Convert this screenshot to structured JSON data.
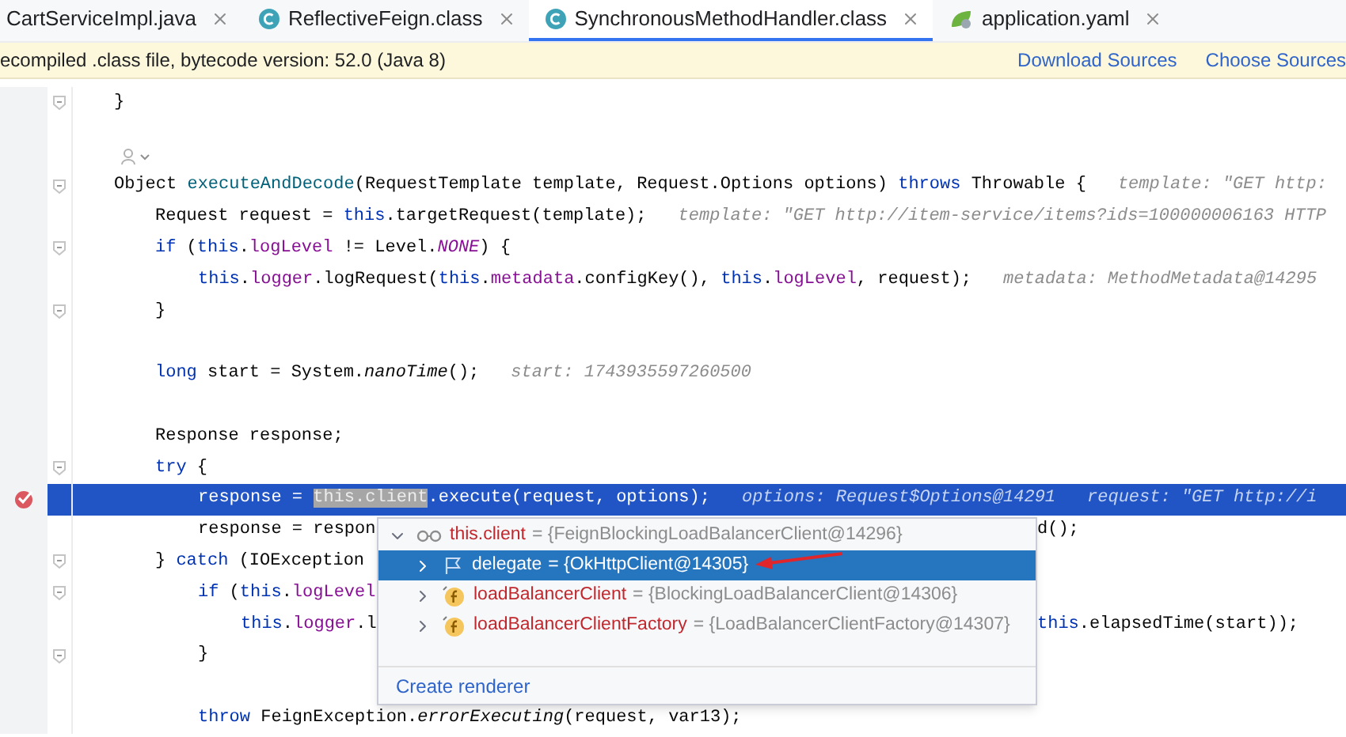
{
  "tabs": [
    {
      "label": "CartServiceImpl.java",
      "kind": "plain",
      "selected": false
    },
    {
      "label": "ReflectiveFeign.class",
      "kind": "class",
      "selected": false
    },
    {
      "label": "SynchronousMethodHandler.class",
      "kind": "class",
      "selected": true
    },
    {
      "label": "application.yaml",
      "kind": "yaml",
      "selected": false
    }
  ],
  "banner": {
    "message": "ecompiled .class file, bytecode version: 52.0 (Java 8)",
    "actions": [
      "Download Sources",
      "Choose Sources"
    ]
  },
  "code_lines": [
    {
      "kind": "code",
      "fold": true,
      "breakpoint": false,
      "highlighted": false,
      "code": [
        {
          "text": "}",
          "kind": "plain"
        }
      ]
    },
    {
      "kind": "blank",
      "fold": false,
      "breakpoint": false,
      "highlighted": false
    },
    {
      "kind": "inlay",
      "fold": false,
      "breakpoint": false,
      "highlighted": false
    },
    {
      "kind": "code",
      "fold": true,
      "breakpoint": false,
      "highlighted": false,
      "code": [
        {
          "text": "Object ",
          "kind": "plain"
        },
        {
          "text": "executeAndDecode",
          "kind": "method"
        },
        {
          "text": "(RequestTemplate template, Request.Options options) ",
          "kind": "plain"
        },
        {
          "text": "throws",
          "kind": "keyword"
        },
        {
          "text": " Throwable {",
          "kind": "plain"
        }
      ],
      "hints": [
        "template: \"GET http:"
      ],
      "children": [
        {
          "kind": "code",
          "fold": false,
          "breakpoint": false,
          "highlighted": false,
          "code": [
            {
              "text": "Request request = ",
              "kind": "plain"
            },
            {
              "text": "this",
              "kind": "keyword"
            },
            {
              "text": ".targetRequest(template);",
              "kind": "plain"
            }
          ],
          "hints": [
            "template: \"GET http://item-service/items?ids=100000006163 HTTP"
          ]
        },
        {
          "kind": "code",
          "fold": true,
          "breakpoint": false,
          "highlighted": false,
          "code": [
            {
              "text": "if",
              "kind": "keyword"
            },
            {
              "text": " (",
              "kind": "plain"
            },
            {
              "text": "this",
              "kind": "keyword"
            },
            {
              "text": ".",
              "kind": "plain"
            },
            {
              "text": "logLevel",
              "kind": "field"
            },
            {
              "text": " != Level.",
              "kind": "plain"
            },
            {
              "text": "NONE",
              "kind": "constant"
            },
            {
              "text": ") {",
              "kind": "plain"
            }
          ],
          "children": [
            {
              "kind": "code",
              "fold": false,
              "breakpoint": false,
              "highlighted": false,
              "code": [
                {
                  "text": "this",
                  "kind": "keyword"
                },
                {
                  "text": ".",
                  "kind": "plain"
                },
                {
                  "text": "logger",
                  "kind": "field"
                },
                {
                  "text": ".logRequest(",
                  "kind": "plain"
                },
                {
                  "text": "this",
                  "kind": "keyword"
                },
                {
                  "text": ".",
                  "kind": "plain"
                },
                {
                  "text": "metadata",
                  "kind": "field"
                },
                {
                  "text": ".configKey(), ",
                  "kind": "plain"
                },
                {
                  "text": "this",
                  "kind": "keyword"
                },
                {
                  "text": ".",
                  "kind": "plain"
                },
                {
                  "text": "logLevel",
                  "kind": "field"
                },
                {
                  "text": ", request);",
                  "kind": "plain"
                }
              ],
              "hints": [
                "metadata: MethodMetadata@14295"
              ]
            }
          ]
        },
        {
          "kind": "code",
          "fold": true,
          "breakpoint": false,
          "highlighted": false,
          "code": [
            {
              "text": "}",
              "kind": "plain"
            }
          ]
        },
        {
          "kind": "empty",
          "fold": false,
          "breakpoint": false,
          "highlighted": false
        },
        {
          "kind": "code",
          "fold": false,
          "breakpoint": false,
          "highlighted": false,
          "code": [
            {
              "text": "long",
              "kind": "keyword"
            },
            {
              "text": " start = System.",
              "kind": "plain"
            },
            {
              "text": "nanoTime",
              "kind": "static_call"
            },
            {
              "text": "();",
              "kind": "plain"
            }
          ],
          "hints": [
            "start: 1743935597260500"
          ]
        },
        {
          "kind": "empty",
          "fold": false,
          "breakpoint": false,
          "highlighted": false
        },
        {
          "kind": "code",
          "fold": false,
          "breakpoint": false,
          "highlighted": false,
          "code": [
            {
              "text": "Response response;",
              "kind": "plain"
            }
          ]
        },
        {
          "kind": "code",
          "fold": true,
          "breakpoint": false,
          "highlighted": false,
          "code": [
            {
              "text": "try",
              "kind": "keyword"
            },
            {
              "text": " {",
              "kind": "plain"
            }
          ],
          "children": [
            {
              "kind": "code",
              "fold": false,
              "breakpoint": true,
              "highlighted": true,
              "code": [
                {
                  "text": "response = ",
                  "kind": "plain"
                },
                {
                  "text": "this.client",
                  "kind": "selection"
                },
                {
                  "text": ".execute(request, options);",
                  "kind": "plain"
                }
              ],
              "hints": [
                "options: Request$Options@14291",
                "request: \"GET http://i"
              ]
            },
            {
              "kind": "code",
              "fold": false,
              "breakpoint": false,
              "highlighted": false,
              "code": [
                {
                  "text": "response = respon",
                  "kind": "plain"
                }
              ],
              "tail": [
                {
                  "text": "d();",
                  "kind": "plain"
                }
              ]
            }
          ]
        },
        {
          "kind": "code",
          "fold": true,
          "breakpoint": false,
          "highlighted": false,
          "code": [
            {
              "text": "} ",
              "kind": "plain"
            },
            {
              "text": "catch",
              "kind": "keyword"
            },
            {
              "text": " (IOException",
              "kind": "plain"
            }
          ],
          "children": [
            {
              "kind": "code",
              "fold": true,
              "breakpoint": false,
              "highlighted": false,
              "code": [
                {
                  "text": "if",
                  "kind": "keyword"
                },
                {
                  "text": " (",
                  "kind": "plain"
                },
                {
                  "text": "this",
                  "kind": "keyword"
                },
                {
                  "text": ".",
                  "kind": "plain"
                },
                {
                  "text": "logLevel",
                  "kind": "field"
                }
              ],
              "children": [
                {
                  "kind": "code",
                  "fold": false,
                  "breakpoint": false,
                  "highlighted": false,
                  "code": [
                    {
                      "text": "this",
                      "kind": "keyword"
                    },
                    {
                      "text": ".",
                      "kind": "plain"
                    },
                    {
                      "text": "logger",
                      "kind": "field"
                    },
                    {
                      "text": ".l",
                      "kind": "plain"
                    }
                  ],
                  "tail": [
                    {
                      "text": "this",
                      "kind": "keyword"
                    },
                    {
                      "text": ".elapsedTime(start));",
                      "kind": "plain"
                    }
                  ]
                }
              ]
            },
            {
              "kind": "code",
              "fold": true,
              "breakpoint": false,
              "highlighted": false,
              "code": [
                {
                  "text": "}",
                  "kind": "plain"
                }
              ]
            },
            {
              "kind": "empty",
              "fold": false,
              "breakpoint": false,
              "highlighted": false
            },
            {
              "kind": "code",
              "fold": false,
              "breakpoint": false,
              "highlighted": false,
              "code": [
                {
                  "text": "throw",
                  "kind": "keyword"
                },
                {
                  "text": " FeignException.",
                  "kind": "plain"
                },
                {
                  "text": "errorExecuting",
                  "kind": "static_call"
                },
                {
                  "text": "(request, var13);",
                  "kind": "plain"
                }
              ]
            }
          ]
        }
      ]
    }
  ],
  "variables_popup": {
    "tree": [
      {
        "name": "this.client",
        "value": "= {FeignBlockingLoadBalancerClient@14296}",
        "kind": "watch",
        "expanded": true,
        "selected": false,
        "children": [
          {
            "name": "delegate",
            "value": "= {OkHttpClient@14305}",
            "kind": "flag",
            "expanded": false,
            "selected": true
          },
          {
            "name": "loadBalancerClient",
            "value": "= {BlockingLoadBalancerClient@14306}",
            "kind": "field",
            "expanded": false,
            "selected": false
          },
          {
            "name": "loadBalancerClientFactory",
            "value": "= {LoadBalancerClientFactory@14307}",
            "kind": "field",
            "expanded": false,
            "selected": false
          }
        ]
      }
    ],
    "action": "Create renderer"
  }
}
